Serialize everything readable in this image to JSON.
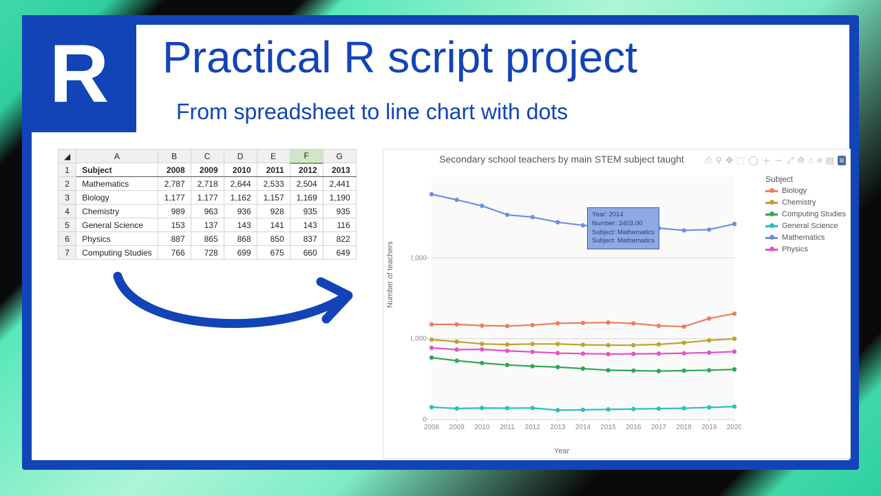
{
  "header": {
    "logo_letter": "R",
    "title": "Practical R script project",
    "subtitle": "From spreadsheet to line chart with dots"
  },
  "spreadsheet": {
    "col_letters": [
      "A",
      "B",
      "C",
      "D",
      "E",
      "F",
      "G"
    ],
    "highlight_col": 5,
    "header_row": [
      "Subject",
      "2008",
      "2009",
      "2010",
      "2011",
      "2012",
      "2013"
    ],
    "rows": [
      [
        "Mathematics",
        "2,787",
        "2,718",
        "2,644",
        "2,533",
        "2,504",
        "2,441"
      ],
      [
        "Biology",
        "1,177",
        "1,177",
        "1,162",
        "1,157",
        "1,169",
        "1,190"
      ],
      [
        "Chemistry",
        "989",
        "963",
        "936",
        "928",
        "935",
        "935"
      ],
      [
        "General Science",
        "153",
        "137",
        "143",
        "141",
        "143",
        "116"
      ],
      [
        "Physics",
        "887",
        "865",
        "868",
        "850",
        "837",
        "822"
      ],
      [
        "Computing Studies",
        "766",
        "728",
        "699",
        "675",
        "660",
        "649"
      ]
    ]
  },
  "chart_data": {
    "type": "line",
    "title": "Secondary school teachers by main STEM subject taught",
    "xlabel": "Year",
    "ylabel": "Number of teachers",
    "legend_title": "Subject",
    "x": [
      2008,
      2009,
      2010,
      2011,
      2012,
      2013,
      2014,
      2015,
      2016,
      2017,
      2018,
      2019,
      2020
    ],
    "ylim": [
      0,
      3000
    ],
    "yticks": [
      0,
      1000,
      2000
    ],
    "series": [
      {
        "name": "Biology",
        "color": "#f07d5e",
        "values": [
          1177,
          1177,
          1162,
          1157,
          1169,
          1190,
          1195,
          1200,
          1190,
          1160,
          1150,
          1250,
          1310
        ]
      },
      {
        "name": "Chemistry",
        "color": "#c2a22b",
        "values": [
          989,
          963,
          936,
          928,
          935,
          935,
          925,
          920,
          920,
          930,
          950,
          980,
          1000
        ]
      },
      {
        "name": "Computing Studies",
        "color": "#2fa851",
        "values": [
          766,
          728,
          699,
          675,
          660,
          649,
          630,
          610,
          605,
          600,
          605,
          610,
          620
        ]
      },
      {
        "name": "General Science",
        "color": "#27c0c0",
        "values": [
          153,
          137,
          143,
          141,
          143,
          116,
          120,
          125,
          130,
          135,
          140,
          150,
          160
        ]
      },
      {
        "name": "Mathematics",
        "color": "#6d8fe0",
        "values": [
          2787,
          2718,
          2644,
          2533,
          2504,
          2441,
          2403,
          2360,
          2350,
          2368,
          2340,
          2350,
          2420
        ]
      },
      {
        "name": "Physics",
        "color": "#e751c3",
        "values": [
          887,
          865,
          868,
          850,
          837,
          822,
          815,
          810,
          812,
          815,
          820,
          828,
          840
        ]
      }
    ],
    "tooltip": {
      "lines": [
        "Year: 2014",
        "Number: 2403.00",
        "Subject: Mathematics",
        "Subject: Mathematics"
      ],
      "x": 2014,
      "series": "Mathematics"
    }
  },
  "toolbar_icons": [
    "camera-icon",
    "zoom-icon",
    "pan-icon",
    "box-select-icon",
    "lasso-icon",
    "zoom-in-icon",
    "zoom-out-icon",
    "autoscale-icon",
    "reset-icon",
    "home-icon",
    "spike-icon",
    "hover-icon",
    "plotly-badge"
  ]
}
